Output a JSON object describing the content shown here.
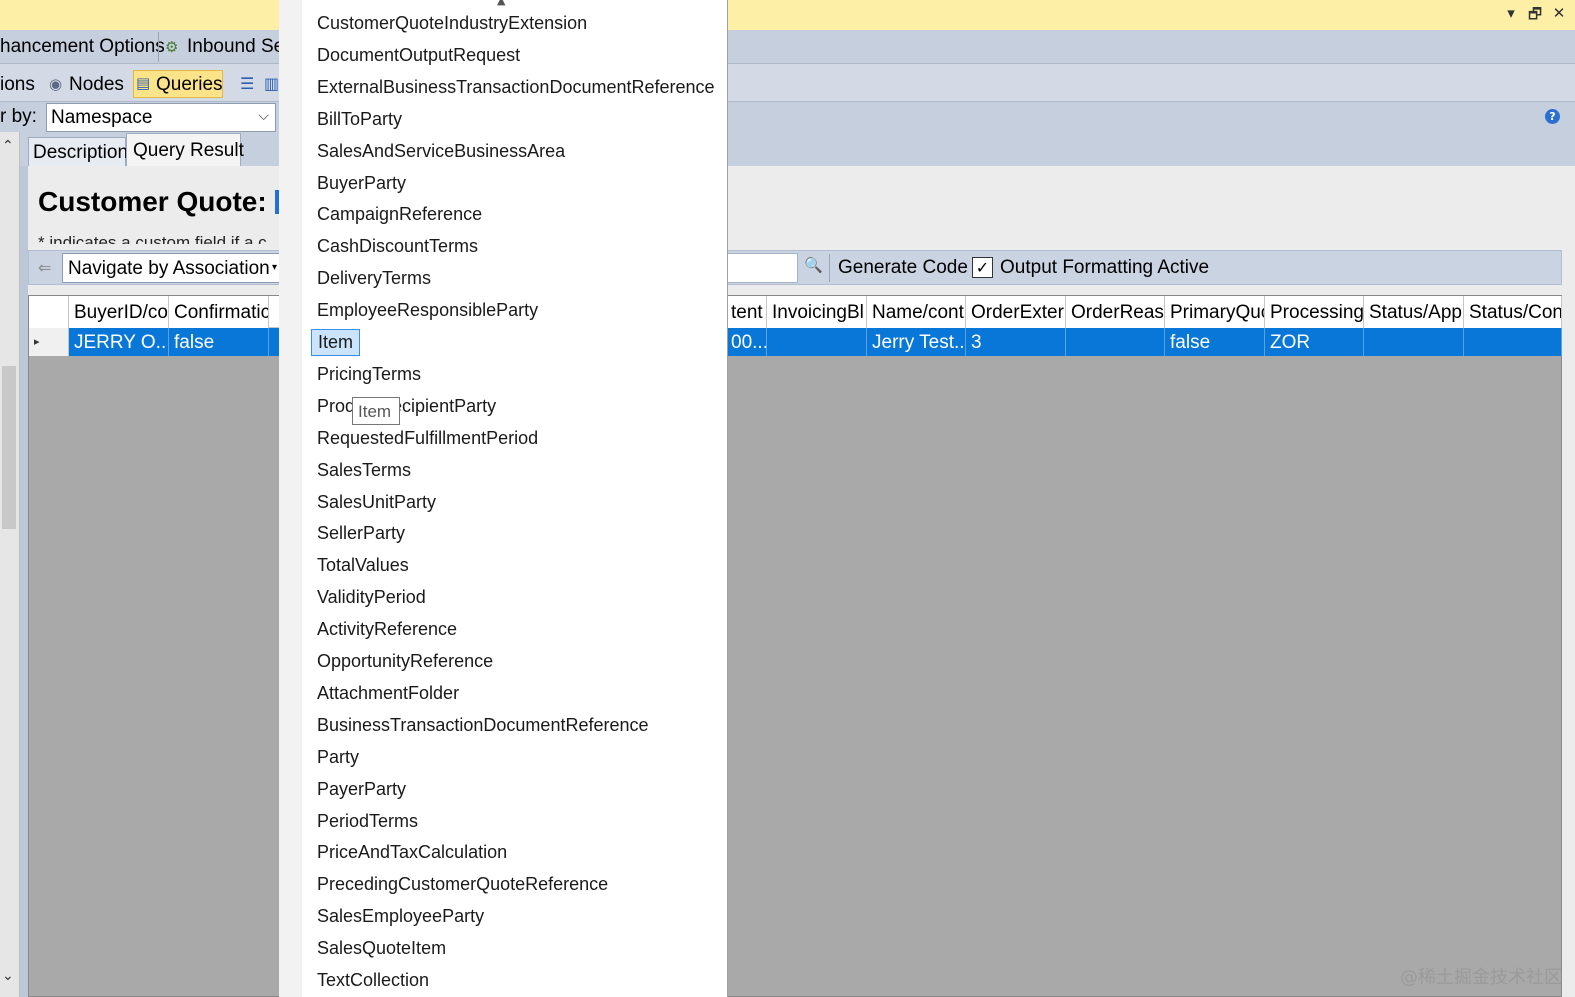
{
  "window": {
    "controls": [
      "▾",
      "🗗",
      "✕"
    ]
  },
  "toolbar1": {
    "enhancement_label": "hancement Options",
    "inbound_label": "Inbound Se"
  },
  "toolbar2": {
    "options_label": "ions",
    "nodes_label": "Nodes",
    "queries_label": "Queries"
  },
  "filter": {
    "label": "r by:",
    "value": "Namespace"
  },
  "tabs": {
    "description": "Description",
    "query_result": "Query Result"
  },
  "main": {
    "heading": "Customer Quote:",
    "hint": "* indicates a custom field if a c"
  },
  "nav": {
    "mode": "Navigate by Association",
    "generate_code": "Generate Code",
    "output_formatting_label": "Output Formatting Active",
    "output_formatting_checked": true
  },
  "grid": {
    "columns_left": [
      "BuyerID/co",
      "Confirmatic"
    ],
    "columns_right": [
      "tent",
      "InvoicingBl",
      "Name/cont",
      "OrderExterr",
      "OrderReasc",
      "PrimaryQuc",
      "ProcessingT",
      "Status/App",
      "Status/Con"
    ],
    "row_left": [
      "JERRY O...",
      "false"
    ],
    "row_right": [
      "00...",
      "",
      "Jerry Test...",
      "3",
      "",
      "false",
      "ZOR",
      "",
      ""
    ]
  },
  "dropdown": {
    "items": [
      "CustomerQuoteIndustryExtension",
      "DocumentOutputRequest",
      "ExternalBusinessTransactionDocumentReference",
      "BillToParty",
      "SalesAndServiceBusinessArea",
      "BuyerParty",
      "CampaignReference",
      "CashDiscountTerms",
      "DeliveryTerms",
      "EmployeeResponsibleParty",
      "Item",
      "PricingTerms",
      "ProductRecipientParty",
      "RequestedFulfillmentPeriod",
      "SalesTerms",
      "SalesUnitParty",
      "SellerParty",
      "TotalValues",
      "ValidityPeriod",
      "ActivityReference",
      "OpportunityReference",
      "AttachmentFolder",
      "BusinessTransactionDocumentReference",
      "Party",
      "PayerParty",
      "PeriodTerms",
      "PriceAndTaxCalculation",
      "PrecedingCustomerQuoteReference",
      "SalesEmployeeParty",
      "SalesQuoteItem",
      "TextCollection"
    ],
    "selected": "Item",
    "tooltip": "Item"
  },
  "watermark": "@稀土掘金技术社区",
  "colors": {
    "selection": "#0877d8",
    "accent": "#fbe38a"
  }
}
